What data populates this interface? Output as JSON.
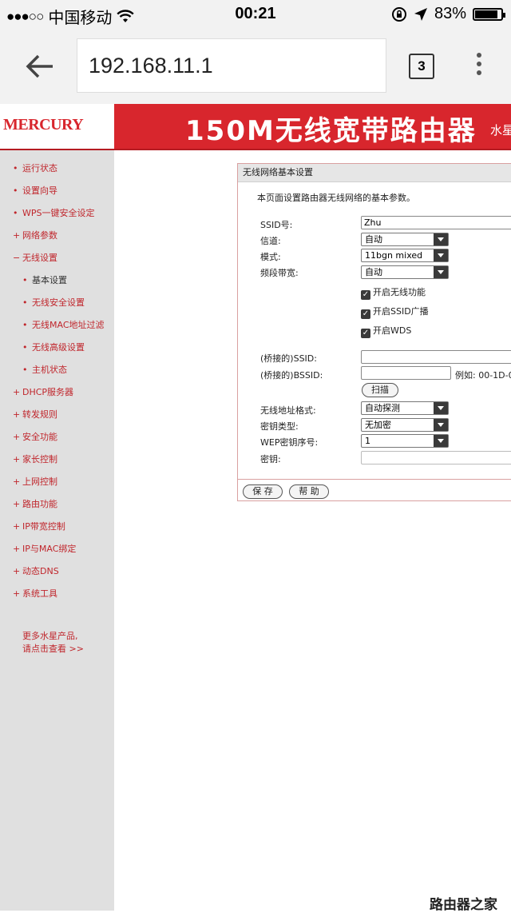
{
  "status_bar": {
    "signal": "●●●○○",
    "carrier": "中国移动",
    "time": "00:21",
    "battery": "83%"
  },
  "browser": {
    "url": "192.168.11.1",
    "tab_count": "3"
  },
  "router": {
    "logo": "MERCURY",
    "header_title": "150M无线宽带路由器",
    "header_extra": "水星"
  },
  "sidebar": {
    "items": [
      {
        "bullet": "•",
        "label": "运行状态"
      },
      {
        "bullet": "•",
        "label": "设置向导"
      },
      {
        "bullet": "•",
        "label": "WPS一键安全设定"
      },
      {
        "bullet": "+",
        "label": "网络参数"
      },
      {
        "bullet": "−",
        "label": "无线设置"
      },
      {
        "bullet": "•",
        "label": "基本设置"
      },
      {
        "bullet": "•",
        "label": "无线安全设置"
      },
      {
        "bullet": "•",
        "label": "无线MAC地址过滤"
      },
      {
        "bullet": "•",
        "label": "无线高级设置"
      },
      {
        "bullet": "•",
        "label": "主机状态"
      },
      {
        "bullet": "+",
        "label": "DHCP服务器"
      },
      {
        "bullet": "+",
        "label": "转发规则"
      },
      {
        "bullet": "+",
        "label": "安全功能"
      },
      {
        "bullet": "+",
        "label": "家长控制"
      },
      {
        "bullet": "+",
        "label": "上网控制"
      },
      {
        "bullet": "+",
        "label": "路由功能"
      },
      {
        "bullet": "+",
        "label": "IP带宽控制"
      },
      {
        "bullet": "+",
        "label": "IP与MAC绑定"
      },
      {
        "bullet": "+",
        "label": "动态DNS"
      },
      {
        "bullet": "+",
        "label": "系统工具"
      }
    ],
    "promo_line1": "更多水星产品,",
    "promo_line2": "请点击查看 >>"
  },
  "panel": {
    "title": "无线网络基本设置",
    "description": "本页面设置路由器无线网络的基本参数。",
    "ssid_label": "SSID号:",
    "ssid_value": "Zhu",
    "channel_label": "信道:",
    "channel_value": "自动",
    "mode_label": "模式:",
    "mode_value": "11bgn mixed",
    "bandwidth_label": "频段带宽:",
    "bandwidth_value": "自动",
    "enable_wireless": "开启无线功能",
    "enable_ssid_broadcast": "开启SSID广播",
    "enable_wds": "开启WDS",
    "bridge_ssid_label": "(桥接的)SSID:",
    "bridge_ssid_value": "",
    "bridge_bssid_label": "(桥接的)BSSID:",
    "bridge_bssid_value": "",
    "bssid_example": "例如: 00-1D-0",
    "scan_button": "扫描",
    "address_format_label": "无线地址格式:",
    "address_format_value": "自动探测",
    "key_type_label": "密钥类型:",
    "key_type_value": "无加密",
    "wep_index_label": "WEP密钥序号:",
    "wep_index_value": "1",
    "key_label": "密钥:",
    "key_value": "",
    "save_button": "保 存",
    "help_button": "帮 助"
  },
  "watermark": "路由器之家"
}
